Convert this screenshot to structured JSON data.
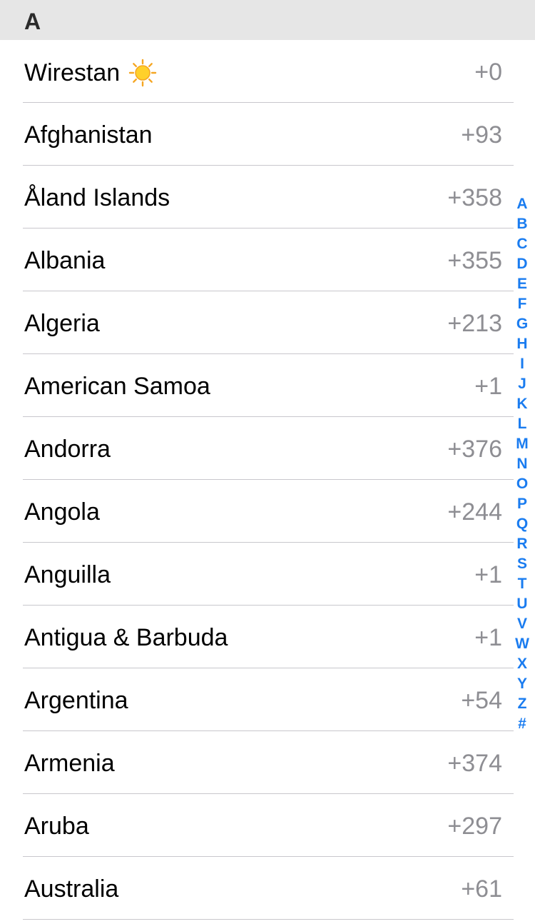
{
  "section": {
    "label": "A"
  },
  "rows": [
    {
      "name": "Wirestan",
      "code": "+0",
      "icon": "sun-icon"
    },
    {
      "name": "Afghanistan",
      "code": "+93"
    },
    {
      "name": "Åland Islands",
      "code": "+358"
    },
    {
      "name": "Albania",
      "code": "+355"
    },
    {
      "name": "Algeria",
      "code": "+213"
    },
    {
      "name": "American Samoa",
      "code": "+1"
    },
    {
      "name": "Andorra",
      "code": "+376"
    },
    {
      "name": "Angola",
      "code": "+244"
    },
    {
      "name": "Anguilla",
      "code": "+1"
    },
    {
      "name": "Antigua & Barbuda",
      "code": "+1"
    },
    {
      "name": "Argentina",
      "code": "+54"
    },
    {
      "name": "Armenia",
      "code": "+374"
    },
    {
      "name": "Aruba",
      "code": "+297"
    },
    {
      "name": "Australia",
      "code": "+61"
    }
  ],
  "index": [
    "A",
    "B",
    "C",
    "D",
    "E",
    "F",
    "G",
    "H",
    "I",
    "J",
    "K",
    "L",
    "M",
    "N",
    "O",
    "P",
    "Q",
    "R",
    "S",
    "T",
    "U",
    "V",
    "W",
    "X",
    "Y",
    "Z",
    "#"
  ],
  "colors": {
    "accent": "#1a7cf0",
    "header_bg": "#e6e6e6",
    "code_text": "#8e8e93",
    "separator": "#c8c7cc"
  }
}
